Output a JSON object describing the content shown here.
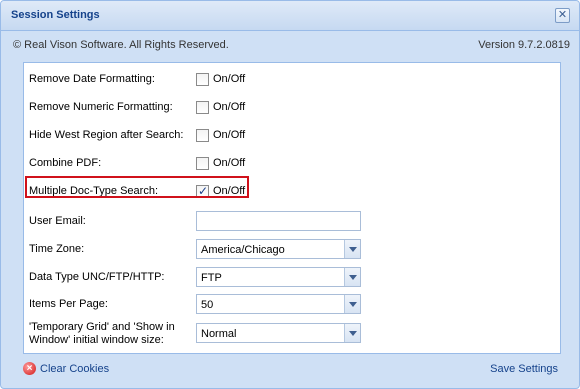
{
  "window": {
    "title": "Session Settings",
    "close_glyph": "✕"
  },
  "info": {
    "copyright": "© Real Vison Software. All Rights Reserved.",
    "version": "Version 9.7.2.0819"
  },
  "fields": {
    "remove_date": {
      "label": "Remove Date Formatting:",
      "toggle": "On/Off",
      "checked": false
    },
    "remove_numeric": {
      "label": "Remove Numeric Formatting:",
      "toggle": "On/Off",
      "checked": false
    },
    "hide_west": {
      "label": "Hide West Region after Search:",
      "toggle": "On/Off",
      "checked": false
    },
    "combine_pdf": {
      "label": "Combine PDF:",
      "toggle": "On/Off",
      "checked": false
    },
    "multiple_doctype": {
      "label": "Multiple Doc-Type Search:",
      "toggle": "On/Off",
      "checked": true
    },
    "user_email": {
      "label": "User Email:",
      "value": ""
    },
    "time_zone": {
      "label": "Time Zone:",
      "value": "America/Chicago"
    },
    "data_type": {
      "label": "Data Type UNC/FTP/HTTP:",
      "value": "FTP"
    },
    "items_per_page": {
      "label": "Items Per Page:",
      "value": "50"
    },
    "window_size": {
      "label_line1": "'Temporary Grid' and 'Show in",
      "label_line2": "Window' initial window size:",
      "value": "Normal"
    }
  },
  "footer": {
    "clear_cookies": "Clear Cookies",
    "save_settings": "Save Settings"
  },
  "colors": {
    "highlight": "#d0111b",
    "title": "#15428b",
    "border": "#99bbe8"
  }
}
